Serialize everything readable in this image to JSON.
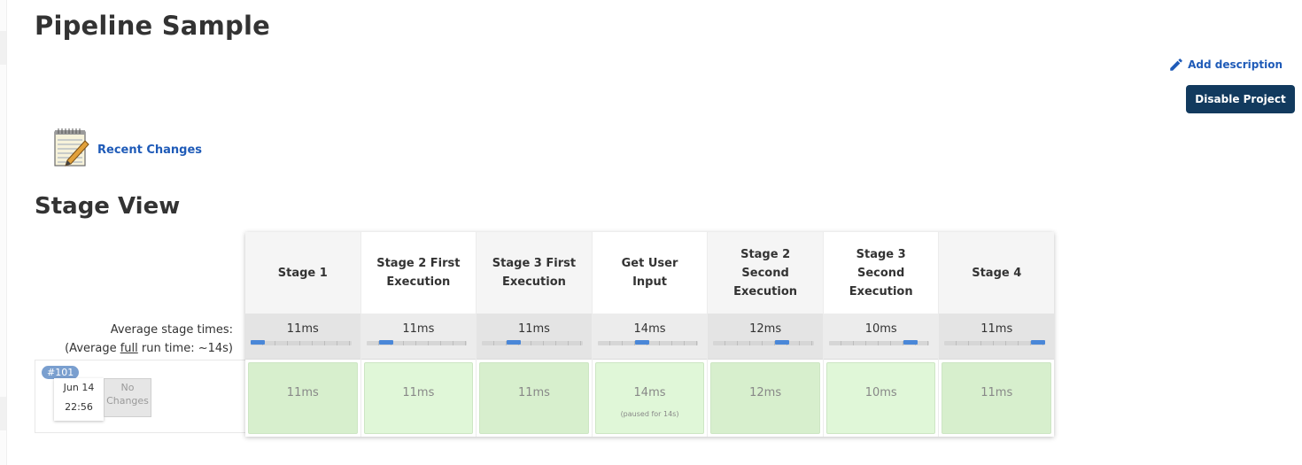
{
  "page": {
    "title": "Pipeline Sample"
  },
  "actions": {
    "add_description": "Add description",
    "disable_project": "Disable Project"
  },
  "recent_changes": {
    "label": "Recent Changes"
  },
  "stage_view": {
    "title": "Stage View",
    "average_label": "Average stage times:",
    "average_full_prefix": "(Average ",
    "average_full_word": "full",
    "average_full_suffix": " run time: ~14s)",
    "stages": [
      {
        "name": "Stage 1",
        "avg": "11ms",
        "bar_position": 0.0,
        "cell": "11ms"
      },
      {
        "name": "Stage 2 First Execution",
        "avg": "11ms",
        "bar_position": 0.14,
        "cell": "11ms"
      },
      {
        "name": "Stage 3 First Execution",
        "avg": "11ms",
        "bar_position": 0.29,
        "cell": "11ms"
      },
      {
        "name": "Get User Input",
        "avg": "14ms",
        "bar_position": 0.43,
        "cell": "14ms",
        "note": "(paused for 14s)"
      },
      {
        "name": "Stage 2 Second Execution",
        "avg": "12ms",
        "bar_position": 0.71,
        "cell": "12ms"
      },
      {
        "name": "Stage 3 Second Execution",
        "avg": "10ms",
        "bar_position": 0.86,
        "cell": "10ms"
      },
      {
        "name": "Stage 4",
        "avg": "11ms",
        "bar_position": 1.0,
        "cell": "11ms"
      }
    ],
    "run": {
      "number": "#101",
      "month_day": "Jun 14",
      "time": "22:56",
      "changes": "No Changes"
    }
  },
  "colors": {
    "accent_link": "#1f5bb8",
    "button_bg": "#123a5e",
    "success_cell": "#e0f7d8",
    "bar_fill": "#4a87d8"
  }
}
